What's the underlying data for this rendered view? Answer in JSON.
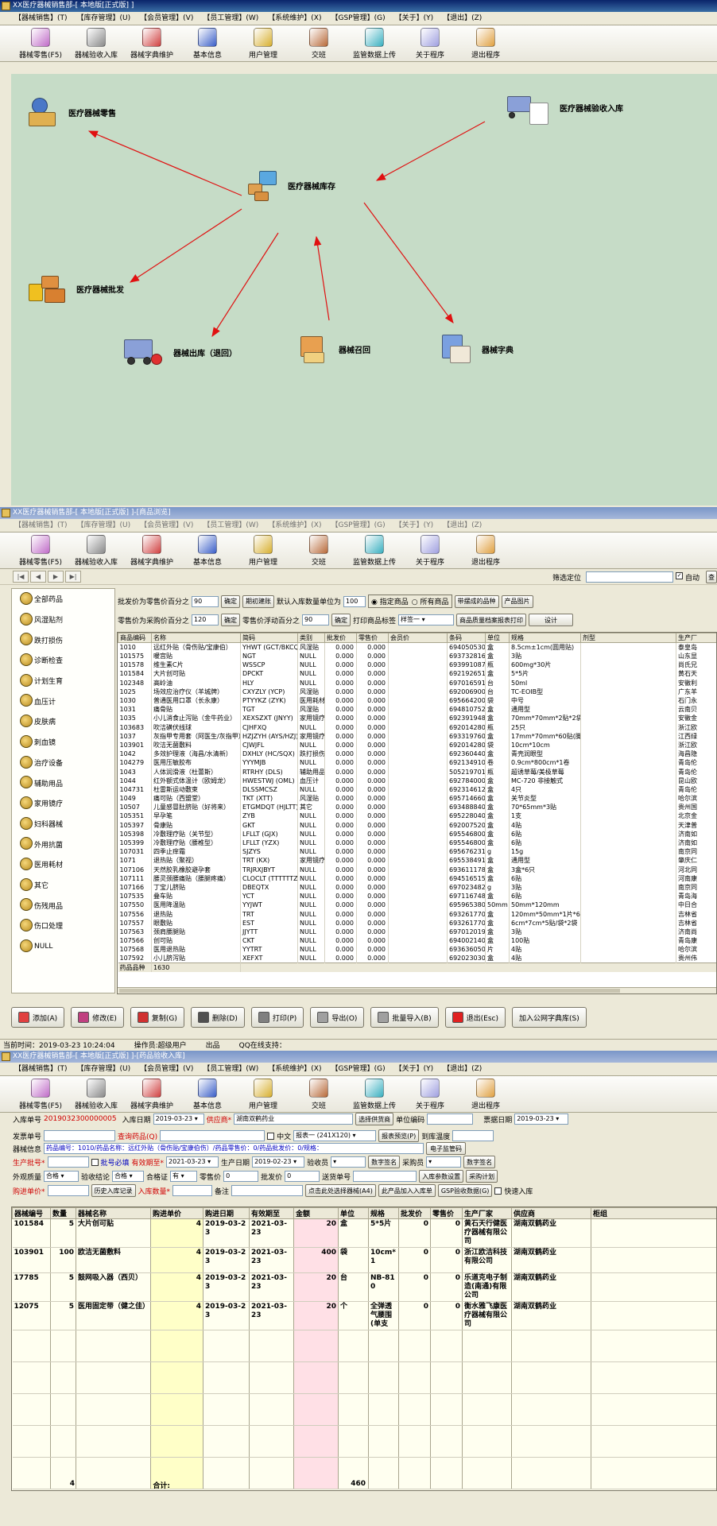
{
  "window1": {
    "title": "XX医疗器械销售部-[ 本地版[正式版] ]",
    "menu": [
      "【器械销售】(T)",
      "【库存管理】(U)",
      "【会员管理】(V)",
      "【员工管理】(W)",
      "【系统维护】(X)",
      "【GSP管理】(G)",
      "【关于】(Y)",
      "【退出】(Z)"
    ],
    "toolbar": [
      {
        "label": "器械零售(F5)",
        "icon": "pill-icon",
        "color": "#c06cc8"
      },
      {
        "label": "器械验收入库",
        "icon": "calculator-icon",
        "color": "#8a8a8a"
      },
      {
        "label": "器械字典维护",
        "icon": "box-icon",
        "color": "#d04040"
      },
      {
        "label": "基本信息",
        "icon": "people-icon",
        "color": "#3a5ec8"
      },
      {
        "label": "用户管理",
        "icon": "keys-icon",
        "color": "#d8b030"
      },
      {
        "label": "交班",
        "icon": "handshake-icon",
        "color": "#b86a3a"
      },
      {
        "label": "监管数据上传",
        "icon": "upload-icon",
        "color": "#3ab0c0"
      },
      {
        "label": "关于程序",
        "icon": "question-icon",
        "color": "#a0a0e0"
      },
      {
        "label": "退出程序",
        "icon": "exit-icon",
        "color": "#e0a040"
      }
    ],
    "nodes": {
      "retail": "医疗器械零售",
      "receive": "医疗器械验收入库",
      "stock": "医疗器械库存",
      "wholesale": "医疗器械批发",
      "outbound": "器械出库（退回）",
      "recall": "器械召回",
      "dictionary": "器械字典"
    }
  },
  "window2": {
    "title": "XX医疗器械销售部-[ 本地版[正式版] ]-[商品浏览]",
    "locate_label": "筛选定位",
    "auto_label": "自动",
    "query_label": "查",
    "categories": [
      "全部药品",
      "风湿贴剂",
      "跌打损伤",
      "诊断检查",
      "计划生育",
      "血压计",
      "皮肤病",
      "刺血镜",
      "治疗设备",
      "辅助用品",
      "家用镜疗",
      "妇科器械",
      "外用抗菌",
      "医用耗材",
      "其它",
      "伤残用品",
      "伤口处理",
      "NULL"
    ],
    "options": {
      "wholesale_pct_label": "批发价为零售价百分之",
      "wholesale_pct_value": "90",
      "confirm": "确定",
      "expiry_check": "期初建账",
      "default_qty_label": "默认入库数量单位为",
      "default_qty_value": "100",
      "radio_specified": "指定商品",
      "radio_all": "所有商品",
      "with_stock": "带摆成的品种",
      "product_image": "产品图片",
      "retail_pct_label": "零售价为采购价百分之",
      "retail_pct_value": "120",
      "confirm2": "确定",
      "float_label": "零售价浮动百分之",
      "float_value": "90",
      "confirm3": "确定",
      "print_label": "打印商品标签",
      "print_select": "样签一",
      "quality_print": "商品质量档案报表打印",
      "design": "设计"
    },
    "columns": [
      "商品编码",
      "名称",
      "简码",
      "类别",
      "批发价",
      "零售价",
      "会员价",
      "条码",
      "单位",
      "规格",
      "剂型",
      "生产厂"
    ],
    "rows": [
      [
        "1010",
        "远红外贴（骨伤贴/宝康伯）",
        "YHWT (GCT/BKCQ)",
        "风湿贴",
        "0.000",
        "0.000",
        "",
        "6940505300",
        "盒",
        "8.5cm±1cm(圆用贴)",
        "",
        "泰皇岛"
      ],
      [
        "101575",
        "暖宫贴",
        "NGT",
        "NULL",
        "0.000",
        "0.000",
        "",
        "6937328161",
        "盒",
        "3贴",
        "",
        "山东显"
      ],
      [
        "101578",
        "维生素C片",
        "WSSCP",
        "NULL",
        "0.000",
        "0.000",
        "",
        "6939910870",
        "瓶",
        "600mg*30片",
        "",
        "尚氏兄"
      ],
      [
        "101584",
        "大片创可贴",
        "DPCKT",
        "NULL",
        "0.000",
        "0.000",
        "",
        "6921926511",
        "盒",
        "5*5片",
        "",
        "黄石天"
      ],
      [
        "102348",
        "高岭油",
        "HLY",
        "NULL",
        "0.000",
        "0.000",
        "",
        "6970165913",
        "台",
        "50ml",
        "",
        "安徽利"
      ],
      [
        "1025",
        "场效应治疗仪（羊城牌）",
        "CXYZLY (YCP)",
        "风湿贴",
        "0.000",
        "0.000",
        "",
        "6920069000",
        "台",
        "TC-EOIB型",
        "",
        "广东羊"
      ],
      [
        "1030",
        "普通医用口罩（长永康）",
        "PTYYKZ (ZYK)",
        "医用耗材",
        "0.000",
        "0.000",
        "",
        "6956642000",
        "袋",
        "中号",
        "",
        "石门永"
      ],
      [
        "1031",
        "痛骨贴",
        "TGT",
        "风湿贴",
        "0.000",
        "0.000",
        "",
        "6948107520",
        "盒",
        "通用型",
        "",
        "云南贝"
      ],
      [
        "1035",
        "小儿消食止泻贴（金牛药业）",
        "XEXSZXT (JNYY)",
        "家用镜疗",
        "0.000",
        "0.000",
        "",
        "6923919480",
        "盒",
        "70mm*70mm*2贴*2袋",
        "",
        "安徽金"
      ],
      [
        "103683",
        "吹洁磺伏线球",
        "CJHFXQ",
        "NULL",
        "0.000",
        "0.000",
        "",
        "6920142800",
        "瓶",
        "25只",
        "",
        "浙江欧"
      ],
      [
        "1037",
        "灰指甲专用套（阿医生/灰指甲）",
        "HZJZYH (AYS/HZJ)",
        "家用镜疗",
        "0.000",
        "0.000",
        "",
        "6933197600",
        "盒",
        "17mm*70mm*60贴(脚)",
        "",
        "江西绿"
      ],
      [
        "103901",
        "吹洁无菌敷料",
        "CJWJFL",
        "NULL",
        "0.000",
        "0.000",
        "",
        "6920142800",
        "袋",
        "10cm*10cm",
        "",
        "浙江欧"
      ],
      [
        "1042",
        "多效护理液（海昌/水清新）",
        "DXHLY (HC/SQX)",
        "跌打损伤",
        "0.000",
        "0.000",
        "",
        "6923604406",
        "盒",
        "青壳润眼型",
        "",
        "海昌隐"
      ],
      [
        "104279",
        "医用压敏胶布",
        "YYYMJB",
        "NULL",
        "0.000",
        "0.000",
        "",
        "6921349107",
        "卷",
        "0.9cm*800cm*1卷",
        "",
        "青岛伦"
      ],
      [
        "1043",
        "人体润滑液（杜蕾斯）",
        "RTRHY (DLS)",
        "辅助用品",
        "0.000",
        "0.000",
        "",
        "5052197019",
        "瓶",
        "超诱草莓/美极草莓",
        "",
        "青岛伦"
      ],
      [
        "1044",
        "红外额式体温计（欧姆龙）",
        "HWESTWJ (OML)",
        "血压计",
        "0.000",
        "0.000",
        "",
        "6927840001",
        "盒",
        "MC-720 非接触式",
        "",
        "昆山欧"
      ],
      [
        "104731",
        "杜雷斯运动敷束",
        "DLSSMCSZ",
        "NULL",
        "0.000",
        "0.000",
        "",
        "6923146121",
        "盒",
        "4只",
        "",
        "青岛伦"
      ],
      [
        "1049",
        "痛可贴（西盟堂）",
        "TKT (XTT)",
        "风湿贴",
        "0.000",
        "0.000",
        "",
        "6957146603",
        "盒",
        "关节炎型",
        "",
        "哈尔滨"
      ],
      [
        "10507",
        "儿童感冒肚脐贴（好将来）",
        "ETGMDQT (HJLTT)",
        "其它",
        "0.000",
        "0.000",
        "",
        "6934888400",
        "盒",
        "70*65mm*3贴",
        "",
        "贵州国"
      ],
      [
        "105351",
        "早孕笔",
        "ZYB",
        "NULL",
        "0.000",
        "0.000",
        "",
        "6952280401",
        "盒",
        "1支",
        "",
        "北京金"
      ],
      [
        "105397",
        "骨康贴",
        "GKT",
        "NULL",
        "0.000",
        "0.000",
        "",
        "6920075202",
        "盒",
        "4贴",
        "",
        "天津普"
      ],
      [
        "105398",
        "冷敷理疗贴（关节型）",
        "LFLLT (GJX)",
        "NULL",
        "0.000",
        "0.000",
        "",
        "6955468000",
        "盒",
        "6贴",
        "",
        "济南如"
      ],
      [
        "105399",
        "冷敷理疗贴（腰椎型）",
        "LFLLT (YZX)",
        "NULL",
        "0.000",
        "0.000",
        "",
        "6955468000",
        "盒",
        "6贴",
        "",
        "济南如"
      ],
      [
        "107031",
        "四季止痒霜",
        "SJZYS",
        "NULL",
        "0.000",
        "0.000",
        "",
        "6956762316",
        "g",
        "15g",
        "",
        "南京同"
      ],
      [
        "1071",
        "退热贴（聚视）",
        "TRT (KX)",
        "家用镜疗",
        "0.000",
        "0.000",
        "",
        "6955384917",
        "盒",
        "通用型",
        "",
        "肇庆仁"
      ],
      [
        "107106",
        "天然胶乳橡胶避孕套",
        "TRJRXJBYT",
        "NULL",
        "0.000",
        "0.000",
        "",
        "6936111785",
        "盒",
        "3盒*6只",
        "",
        "河北同"
      ],
      [
        "107111",
        "腰灵颈腰痛贴（腰腿疼痛）",
        "CLOCLT (TTTTTTZT)",
        "NULL",
        "0.000",
        "0.000",
        "",
        "6945165159",
        "盒",
        "6贴",
        "",
        "河南康"
      ],
      [
        "107166",
        "丁宝儿脐贴",
        "DBEQTX",
        "NULL",
        "0.000",
        "0.000",
        "",
        "6970234820",
        "g",
        "3贴",
        "",
        "南京同"
      ],
      [
        "107535",
        "叠车贴",
        "YCT",
        "NULL",
        "0.000",
        "0.000",
        "",
        "6971167480",
        "盒",
        "6贴",
        "",
        "青岛海"
      ],
      [
        "107550",
        "医用降温贴",
        "YYJWT",
        "NULL",
        "0.000",
        "0.000",
        "",
        "6959653800",
        "50mm",
        "50mm*120mm",
        "",
        "中日合"
      ],
      [
        "107556",
        "退热贴",
        "TRT",
        "NULL",
        "0.000",
        "0.000",
        "",
        "6932617700",
        "盒",
        "120mm*50mm*1片*6袋",
        "",
        "吉林省"
      ],
      [
        "107557",
        "眼敷贴",
        "EST",
        "NULL",
        "0.000",
        "0.000",
        "",
        "6932617701",
        "盒",
        "6cm*7cm*5贴/袋*2袋",
        "",
        "吉林省"
      ],
      [
        "107563",
        "颈肩腰腿贴",
        "JJYTT",
        "NULL",
        "0.000",
        "0.000",
        "",
        "6970120192",
        "盒",
        "3贴",
        "",
        "济南尚"
      ],
      [
        "107566",
        "创可贴",
        "CKT",
        "NULL",
        "0.000",
        "0.000",
        "",
        "6940021401",
        "盒",
        "100贴",
        "",
        "青岛康"
      ],
      [
        "107568",
        "医用退热贴",
        "YYTRT",
        "NULL",
        "0.000",
        "0.000",
        "",
        "6936360501",
        "片",
        "4贴",
        "",
        "哈尔滨"
      ],
      [
        "107592",
        "小儿脐泻贴",
        "XEFXT",
        "NULL",
        "0.000",
        "0.000",
        "",
        "6920230300",
        "盒",
        "4贴",
        "",
        "贵州伟"
      ]
    ],
    "footer_label": "药品品种",
    "footer_count": "1630",
    "buttons": [
      "添加(A)",
      "修改(E)",
      "复制(G)",
      "删除(D)",
      "打印(P)",
      "导出(O)",
      "批量导入(B)",
      "退出(Esc)",
      "加入公网字典库(S)"
    ],
    "status": [
      "当前时间：2019-03-23 10:24:04",
      "操作员:超级用户",
      "出品",
      "QQ在线支持："
    ]
  },
  "window3": {
    "title": "XX医疗器械销售部-[ 本地版[正式版] ]-[药品验收入库]",
    "form": {
      "order_no_label": "入库单号",
      "order_no": "2019032300000005",
      "date_label": "入库日期",
      "date": "2019-03-23",
      "supplier_label": "供应商*",
      "supplier": "湖南双鹤药业",
      "select_supplier": "选择供货商",
      "unit_code_label": "单位编码",
      "invoice_date_label": "票据日期",
      "invoice_date": "2019-03-23",
      "invoice_no_label": "发票单号",
      "query_drug_label": "查询药品(Q)",
      "chinese_label": "中文",
      "report_select": "报表一 (241X120)",
      "report_preview": "报表预览(P)",
      "temp_label": "到库温度",
      "info_label": "器械信息",
      "info_text": "药品编号：1010/药品名称：远红外贴（骨伤贴/宝康伯伤）/药品零售价：0/药品批发价：0/规格：",
      "ecode": "电子监管码",
      "batch_label": "生产批号*",
      "batch_required": "批号必填",
      "expiry_label": "有效期至*",
      "expiry": "2021-03-23",
      "mfg_label": "生产日期",
      "mfg": "2019-02-23",
      "inspector_label": "验收员",
      "sign1": "数字签名",
      "buyer_label": "采购员",
      "sign2": "数字签名",
      "appearance_label": "外观质量",
      "appearance": "合格",
      "conclusion_label": "验收结论",
      "conclusion": "合格",
      "cert_label": "合格证",
      "cert": "有",
      "retail_label": "零售价",
      "retail": "0",
      "wholesale_label": "批发价",
      "wholesale": "0",
      "delivery_label": "送货单号",
      "param_btn": "入库参数设置",
      "plan_btn": "采购计划",
      "price_label": "购进单价*",
      "history_btn": "历史入库记录",
      "qty_label": "入库数量*",
      "note_label": "备注",
      "batch_select": "点击此处选择器械(A4)",
      "batch_add": "此产品加入入库单",
      "gsp_btn": "GSP验收数据(G)",
      "fast_label": "快速入库"
    },
    "columns": [
      "器械编号",
      "数量",
      "器械名称",
      "购进单价",
      "购进日期",
      "有效期至",
      "金额",
      "单位",
      "规格",
      "批发价",
      "零售价",
      "生产厂家",
      "供应商",
      "柜组"
    ],
    "rows": [
      [
        "101584",
        "5",
        "大片创可贴",
        "4",
        "2019-03-23",
        "2021-03-23",
        "20",
        "盒",
        "5*5片",
        "0",
        "0",
        "黄石天行健医疗器械有限公司",
        "湖南双鹤药业",
        ""
      ],
      [
        "103901",
        "100",
        "欧洁无菌敷料",
        "4",
        "2019-03-23",
        "2021-03-23",
        "400",
        "袋",
        "10cm*1",
        "0",
        "0",
        "浙江欧洁科技有限公司",
        "湖南双鹤药业",
        ""
      ],
      [
        "17785",
        "5",
        "鼓网吸入器（西贝）",
        "4",
        "2019-03-23",
        "2021-03-23",
        "20",
        "台",
        "NB-810",
        "0",
        "0",
        "乐道克电子制造(南通)有限公司",
        "湖南双鹤药业",
        ""
      ],
      [
        "12075",
        "5",
        "医用固定带（健之佳）",
        "4",
        "2019-03-23",
        "2021-03-23",
        "20",
        "个",
        "全弹透气腰围(单支",
        "0",
        "0",
        "衡水雅飞康医疗器械有限公司",
        "湖南双鹤药业",
        ""
      ]
    ],
    "footer": {
      "count": "4",
      "total_label": "合计:",
      "total": "460"
    }
  }
}
